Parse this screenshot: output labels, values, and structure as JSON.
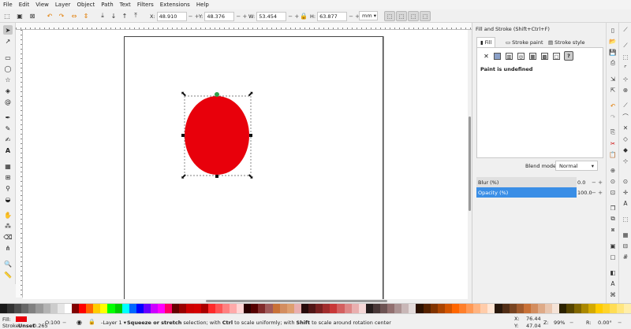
{
  "menu": [
    "File",
    "Edit",
    "View",
    "Layer",
    "Object",
    "Path",
    "Text",
    "Filters",
    "Extensions",
    "Help"
  ],
  "toolbar": {
    "x_label": "X:",
    "x_value": "48.910",
    "y_label": "Y:",
    "y_value": "48.376",
    "w_label": "W:",
    "w_value": "53.454",
    "h_label": "H:",
    "h_value": "63.877",
    "unit": "mm"
  },
  "canvas": {
    "shape_color": "#e8000b",
    "selection_handle_color": "#111111",
    "rotation_center_color": "#2fa04a"
  },
  "dock": {
    "title": "Fill and Stroke (Shift+Ctrl+F)",
    "tabs": [
      "Fill",
      "Stroke paint",
      "Stroke style"
    ],
    "active_tab": "Fill",
    "paint_message": "Paint is undefined",
    "blend_label": "Blend mode:",
    "blend_value": "Normal",
    "blur_label": "Blur (%)",
    "blur_value": "0.0",
    "opacity_label": "Opacity (%)",
    "opacity_value": "100.0",
    "accent_color": "#3a8ee6"
  },
  "status": {
    "fill_label": "Fill:",
    "fill_color": "#e8000b",
    "stroke_label": "Stroke:",
    "stroke_value": "Unset",
    "stroke_width": "0.265",
    "opacity_label": "O:",
    "opacity_value": "100",
    "layer": "-Layer 1",
    "message_bold1": "Squeeze or stretch",
    "message_mid1": " selection; with ",
    "message_bold2": "Ctrl",
    "message_mid2": " to scale uniformly; with ",
    "message_bold3": "Shift",
    "message_end": " to scale around rotation center",
    "x_label": "X:",
    "x_value": "76.44",
    "y_label": "Y:",
    "y_value": "47.04",
    "z_label": "Z:",
    "zoom": "99%",
    "r_label": "R:",
    "rotation": "0.00°"
  },
  "palette": [
    "#1a1a1a",
    "#333333",
    "#4d4d4d",
    "#666666",
    "#808080",
    "#999999",
    "#b3b3b3",
    "#cccccc",
    "#e6e6e6",
    "#ffffff",
    "#800000",
    "#ff0000",
    "#ff6600",
    "#ffcc00",
    "#ffff00",
    "#00ff00",
    "#00cc00",
    "#00ffff",
    "#0066ff",
    "#0000ff",
    "#6600ff",
    "#cc00ff",
    "#ff00ff",
    "#ff0066",
    "#660000",
    "#990000",
    "#cc0000",
    "#d40000",
    "#aa0000",
    "#ff2a2a",
    "#ff5555",
    "#ff8080",
    "#ffaaaa",
    "#ffd5d5",
    "#2b0000",
    "#550000",
    "#802b2b",
    "#a05a5a",
    "#c87137",
    "#d38d5f",
    "#de9f6f",
    "#e9afaf",
    "#280b0b",
    "#501616",
    "#782121",
    "#a02c2c",
    "#c83737",
    "#d35f5f",
    "#de8787",
    "#e9afaf",
    "#f4d7d7",
    "#241c1c",
    "#483737",
    "#6c5353",
    "#916f6f",
    "#ac9393",
    "#c8b7b7",
    "#e3dbdb",
    "#2b1100",
    "#552200",
    "#803300",
    "#aa4400",
    "#d45500",
    "#ff6600",
    "#ff7f2a",
    "#ff9955",
    "#ffb380",
    "#ffccaa",
    "#ffe6d5",
    "#28170b",
    "#502d16",
    "#784421",
    "#a05a2c",
    "#c87137",
    "#d38d5f",
    "#deaa87",
    "#e9c6af",
    "#f4e3d7",
    "#2b2200",
    "#554400",
    "#806600",
    "#aa8800",
    "#d4aa00",
    "#ffcc00",
    "#ffd42a",
    "#ffdd55",
    "#ffe680",
    "#ffeeaa"
  ]
}
